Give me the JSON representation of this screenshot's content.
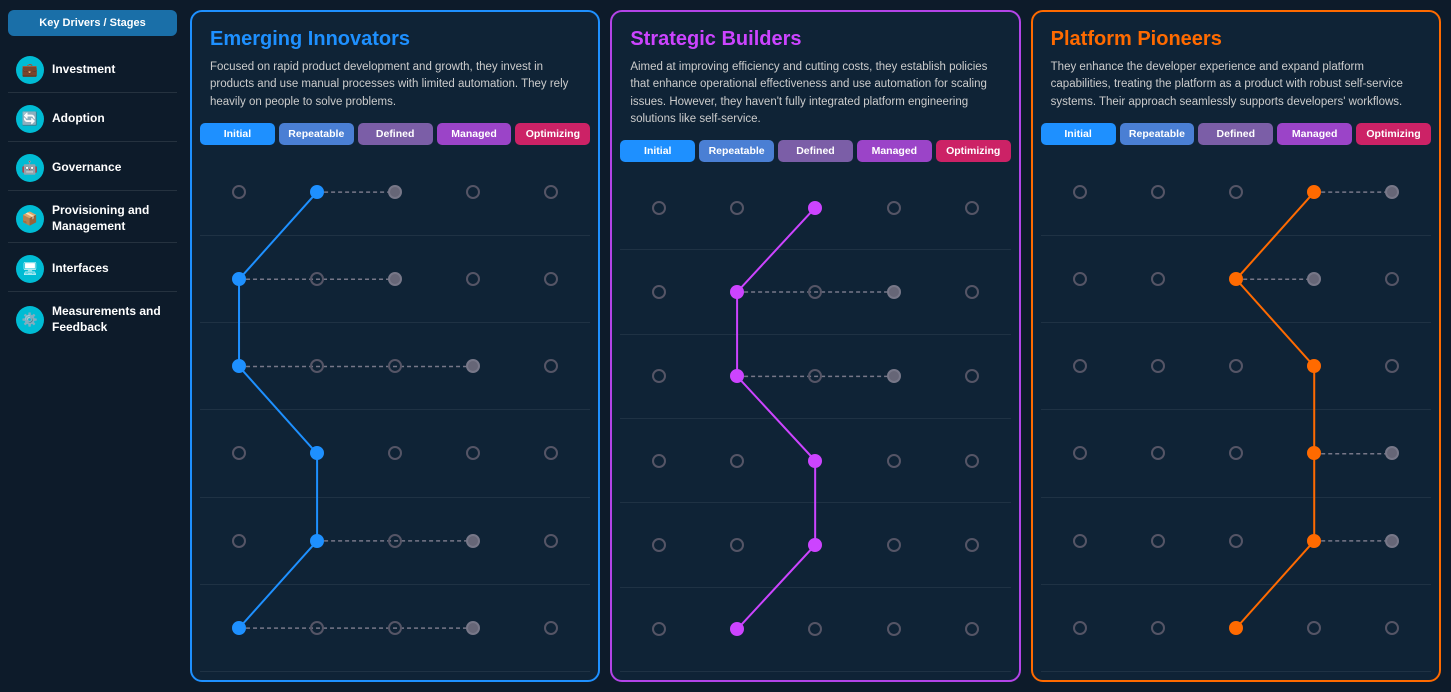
{
  "sidebar": {
    "header_label": "Key Drivers / Stages",
    "items": [
      {
        "id": "investment",
        "label": "Investment",
        "icon": "💼"
      },
      {
        "id": "adoption",
        "label": "Adoption",
        "icon": "🔄"
      },
      {
        "id": "governance",
        "label": "Governance",
        "icon": "🤖"
      },
      {
        "id": "provisioning",
        "label": "Provisioning and Management",
        "icon": "📦"
      },
      {
        "id": "interfaces",
        "label": "Interfaces",
        "icon": "🖥"
      },
      {
        "id": "measurements",
        "label": "Measurements and Feedback",
        "icon": "⚙️"
      }
    ]
  },
  "columns": [
    {
      "id": "emerging",
      "color": "blue",
      "title": "Emerging Innovators",
      "description": "Focused on rapid product development and growth, they invest in products and use manual processes with limited automation. They rely heavily on people to solve problems.",
      "stages": [
        "Initial",
        "Repeatable",
        "Defined",
        "Managed",
        "Optimizing"
      ],
      "rows": [
        {
          "dots": [
            2,
            1,
            3,
            0,
            0
          ]
        },
        {
          "dots": [
            1,
            0,
            3,
            0,
            0
          ]
        },
        {
          "dots": [
            1,
            0,
            0,
            2,
            0
          ]
        },
        {
          "dots": [
            0,
            1,
            0,
            0,
            0
          ]
        },
        {
          "dots": [
            0,
            1,
            0,
            0,
            0
          ]
        },
        {
          "dots": [
            1,
            0,
            0,
            2,
            0
          ]
        }
      ],
      "lineColor": "#1e90ff",
      "linePoints": [
        [
          0,
          0
        ],
        [
          1,
          1
        ],
        [
          2,
          1
        ],
        [
          3,
          2
        ],
        [
          4,
          3
        ],
        [
          5,
          0
        ]
      ]
    },
    {
      "id": "strategic",
      "color": "purple",
      "title": "Strategic Builders",
      "description": "Aimed at improving efficiency and cutting costs, they establish policies that enhance operational effectiveness and use automation for scaling issues. However, they haven't fully integrated platform engineering solutions like self-service.",
      "stages": [
        "Initial",
        "Repeatable",
        "Defined",
        "Managed",
        "Optimizing"
      ],
      "rows": [
        {
          "dots": [
            0,
            0,
            1,
            0,
            0
          ]
        },
        {
          "dots": [
            0,
            1,
            0,
            3,
            0
          ]
        },
        {
          "dots": [
            0,
            1,
            0,
            2,
            0
          ]
        },
        {
          "dots": [
            0,
            0,
            1,
            0,
            0
          ]
        },
        {
          "dots": [
            0,
            0,
            1,
            0,
            0
          ]
        },
        {
          "dots": [
            0,
            1,
            0,
            0,
            0
          ]
        }
      ],
      "lineColor": "#cc44ff",
      "linePoints": [
        [
          0,
          2
        ],
        [
          1,
          1
        ],
        [
          2,
          1
        ],
        [
          3,
          2
        ],
        [
          4,
          2
        ],
        [
          5,
          1
        ]
      ]
    },
    {
      "id": "platform",
      "color": "orange",
      "title": "Platform Pioneers",
      "description": "They enhance the developer experience and expand platform capabilities, treating the platform as a product with robust self-service systems. Their approach seamlessly supports developers' workflows.",
      "stages": [
        "Initial",
        "Repeatable",
        "Defined",
        "Managed",
        "Optimizing"
      ],
      "rows": [
        {
          "dots": [
            0,
            0,
            0,
            1,
            3
          ]
        },
        {
          "dots": [
            0,
            0,
            1,
            3,
            0
          ]
        },
        {
          "dots": [
            0,
            0,
            0,
            1,
            0
          ]
        },
        {
          "dots": [
            0,
            0,
            0,
            1,
            3
          ]
        },
        {
          "dots": [
            0,
            0,
            0,
            1,
            3
          ]
        },
        {
          "dots": [
            0,
            0,
            1,
            0,
            0
          ]
        }
      ],
      "lineColor": "#ff6a00",
      "linePoints": [
        [
          0,
          3
        ],
        [
          1,
          2
        ],
        [
          2,
          3
        ],
        [
          3,
          3
        ],
        [
          4,
          3
        ],
        [
          5,
          2
        ]
      ]
    }
  ]
}
